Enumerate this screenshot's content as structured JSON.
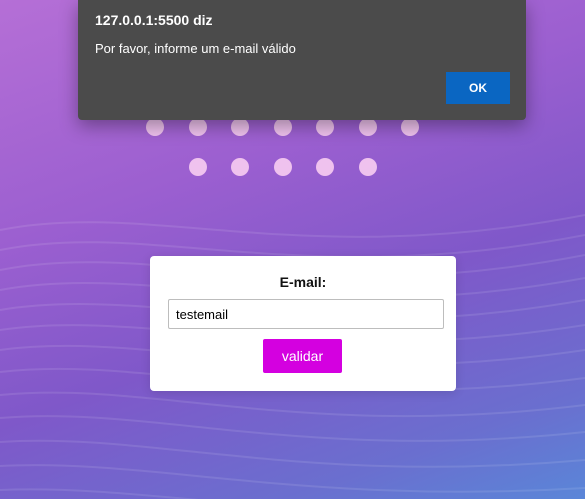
{
  "alert": {
    "title": "127.0.0.1:5500 diz",
    "message": "Por favor, informe um e-mail válido",
    "ok_label": "OK"
  },
  "form": {
    "email_label": "E-mail:",
    "email_value": "testemail",
    "validate_label": "validar"
  },
  "colors": {
    "alert_bg": "#4b4b4b",
    "ok_button": "#0a66c2",
    "validate_button": "#d400e0",
    "dots": "#f3c7ef"
  }
}
